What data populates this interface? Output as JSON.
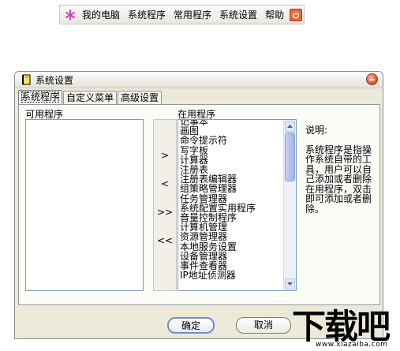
{
  "toolbar": {
    "items": [
      "我的电脑",
      "系统程序",
      "常用程序",
      "系统设置",
      "帮助"
    ],
    "logo_icon": "pinwheel-icon",
    "power_icon": "power-icon"
  },
  "window": {
    "title": "系统设置",
    "tabs": [
      "系统程序",
      "自定义菜单",
      "高级设置"
    ],
    "active_tab": 0,
    "available_label": "可用程序",
    "installed_label": "在用程序",
    "arrow_buttons": [
      ">",
      "<",
      ">>",
      "<<"
    ],
    "installed_items": [
      "记事本",
      "画图",
      "命令提示符",
      "写字板",
      "计算器",
      "注册表",
      "注册表编辑器",
      "组策略管理器",
      "任务管理器",
      "系统配置实用程序",
      "音量控制程序",
      "计算机管理",
      "资源管理器",
      "本地服务设置",
      "设备管理器",
      "事件查看器",
      "IP地址侦测器"
    ],
    "description": {
      "title": "说明:",
      "text": "系统程序是指操作系统自带的工具，用户可以自己添加或者删除在用程序，双击即可添加或者删除。"
    },
    "ok_label": "确定",
    "cancel_label": "取消"
  },
  "watermark": {
    "logo_text": "下载吧",
    "url": "www.xiazaiba.com"
  },
  "colors": {
    "window_bg": "#ece9d8",
    "accent": "#6f8fd0",
    "close": "#e0603c"
  }
}
